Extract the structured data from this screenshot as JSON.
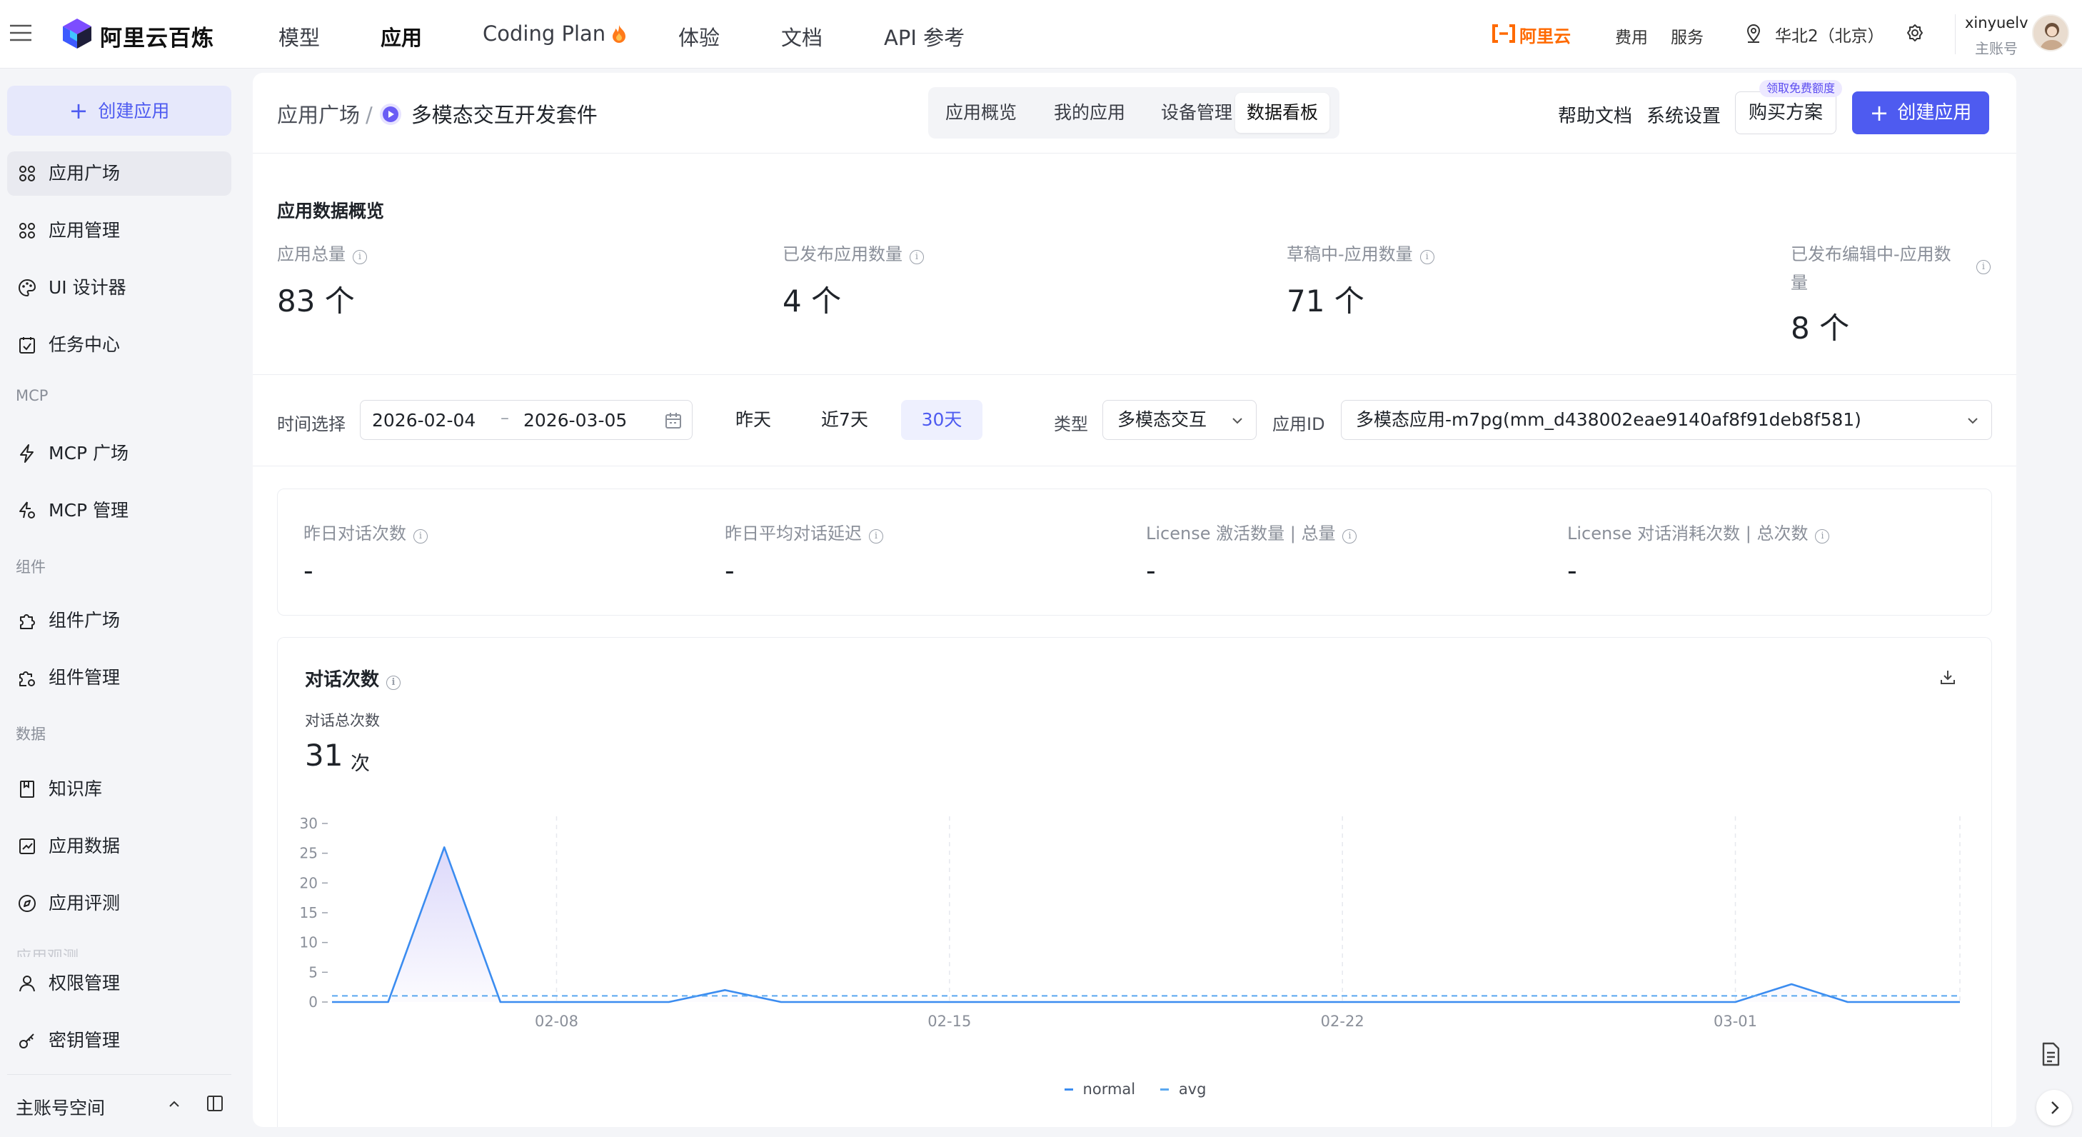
{
  "brand": {
    "name": "阿里云百炼"
  },
  "topnav": [
    {
      "label": "模型"
    },
    {
      "label": "应用"
    },
    {
      "label": "Coding Plan"
    },
    {
      "label": "体验"
    },
    {
      "label": "文档"
    },
    {
      "label": "API 参考"
    }
  ],
  "topright": {
    "aliyun": "阿里云",
    "fee": "费用",
    "service": "服务",
    "region": "华北2（北京）",
    "username": "xinyuelv",
    "account_type": "主账号"
  },
  "sidebar": {
    "create_label": "创建应用",
    "items": [
      {
        "label": "应用广场",
        "icon": "grid-icon"
      },
      {
        "label": "应用管理",
        "icon": "grid-icon"
      },
      {
        "label": "UI 设计器",
        "icon": "palette-icon"
      },
      {
        "label": "任务中心",
        "icon": "task-icon"
      },
      {
        "label": "MCP 广场",
        "icon": "bolt-icon"
      },
      {
        "label": "MCP 管理",
        "icon": "bolt-gear-icon"
      },
      {
        "label": "组件广场",
        "icon": "puzzle-icon"
      },
      {
        "label": "组件管理",
        "icon": "puzzle-gear-icon"
      },
      {
        "label": "知识库",
        "icon": "book-icon"
      },
      {
        "label": "应用数据",
        "icon": "chart-icon"
      },
      {
        "label": "应用评测",
        "icon": "compass-icon"
      },
      {
        "label": "权限管理",
        "icon": "user-icon"
      },
      {
        "label": "密钥管理",
        "icon": "key-icon"
      }
    ],
    "groups": {
      "mcp": "MCP",
      "component": "组件",
      "data": "数据"
    },
    "faded_item": "应用观测",
    "footer": "主账号空间"
  },
  "header": {
    "breadcrumb_root": "应用广场",
    "breadcrumb_current": "多模态交互开发套件",
    "tabs": [
      {
        "label": "应用概览"
      },
      {
        "label": "我的应用"
      },
      {
        "label": "设备管理"
      },
      {
        "label": "数据看板"
      }
    ],
    "help": "帮助文档",
    "settings": "系统设置",
    "buy": "购买方案",
    "free_badge": "领取免费额度",
    "create": "创建应用"
  },
  "overview": {
    "title": "应用数据概览",
    "stats": [
      {
        "label": "应用总量",
        "value": "83 个"
      },
      {
        "label": "已发布应用数量",
        "value": "4 个"
      },
      {
        "label": "草稿中-应用数量",
        "value": "71 个"
      },
      {
        "label_line1": "已发布编辑中-应用数",
        "label_line2": "量",
        "value": "8 个"
      }
    ]
  },
  "filters": {
    "time_label": "时间选择",
    "start_date": "2026-02-04",
    "end_date": "2026-03-05",
    "quick": [
      {
        "label": "昨天"
      },
      {
        "label": "近7天"
      },
      {
        "label": "30天"
      }
    ],
    "active_quick": "30天",
    "type_label": "类型",
    "type_value": "多模态交互",
    "app_id_label": "应用ID",
    "app_id_value": "多模态应用-m7pg(mm_d438002eae9140af8f91deb8f581)"
  },
  "metrics": [
    {
      "label": "昨日对话次数",
      "value": "-"
    },
    {
      "label": "昨日平均对话延迟",
      "value": "-"
    },
    {
      "label": "License 激活数量 | 总量",
      "value": "-"
    },
    {
      "label": "License 对话消耗次数 | 总次数",
      "value": "-"
    }
  ],
  "chart_card": {
    "title": "对话次数",
    "subtitle": "对话总次数",
    "total": "31",
    "unit": "次"
  },
  "chart_data": {
    "type": "line",
    "x": [
      "02-04",
      "02-05",
      "02-06",
      "02-07",
      "02-08",
      "02-09",
      "02-10",
      "02-11",
      "02-12",
      "02-13",
      "02-14",
      "02-15",
      "02-16",
      "02-17",
      "02-18",
      "02-19",
      "02-20",
      "02-21",
      "02-22",
      "02-23",
      "02-24",
      "02-25",
      "02-26",
      "02-27",
      "02-28",
      "03-01",
      "03-02",
      "03-03",
      "03-04",
      "03-05"
    ],
    "xticks": [
      "02-08",
      "02-15",
      "02-22",
      "03-01"
    ],
    "yticks": [
      0,
      5,
      10,
      15,
      20,
      25,
      30
    ],
    "ylim": [
      0,
      30
    ],
    "series": [
      {
        "name": "normal",
        "color": "#3b8cf0",
        "style": "solid-area",
        "values": [
          0,
          0,
          26,
          0,
          0,
          0,
          0,
          2,
          0,
          0,
          0,
          0,
          0,
          0,
          0,
          0,
          0,
          0,
          0,
          0,
          0,
          0,
          0,
          0,
          0,
          0,
          3,
          0,
          0,
          0
        ]
      },
      {
        "name": "avg",
        "color": "#5aa8f0",
        "style": "dashed",
        "values": [
          1.03,
          1.03,
          1.03,
          1.03,
          1.03,
          1.03,
          1.03,
          1.03,
          1.03,
          1.03,
          1.03,
          1.03,
          1.03,
          1.03,
          1.03,
          1.03,
          1.03,
          1.03,
          1.03,
          1.03,
          1.03,
          1.03,
          1.03,
          1.03,
          1.03,
          1.03,
          1.03,
          1.03,
          1.03,
          1.03
        ]
      }
    ],
    "grid": true,
    "legend": "bottom-center"
  }
}
